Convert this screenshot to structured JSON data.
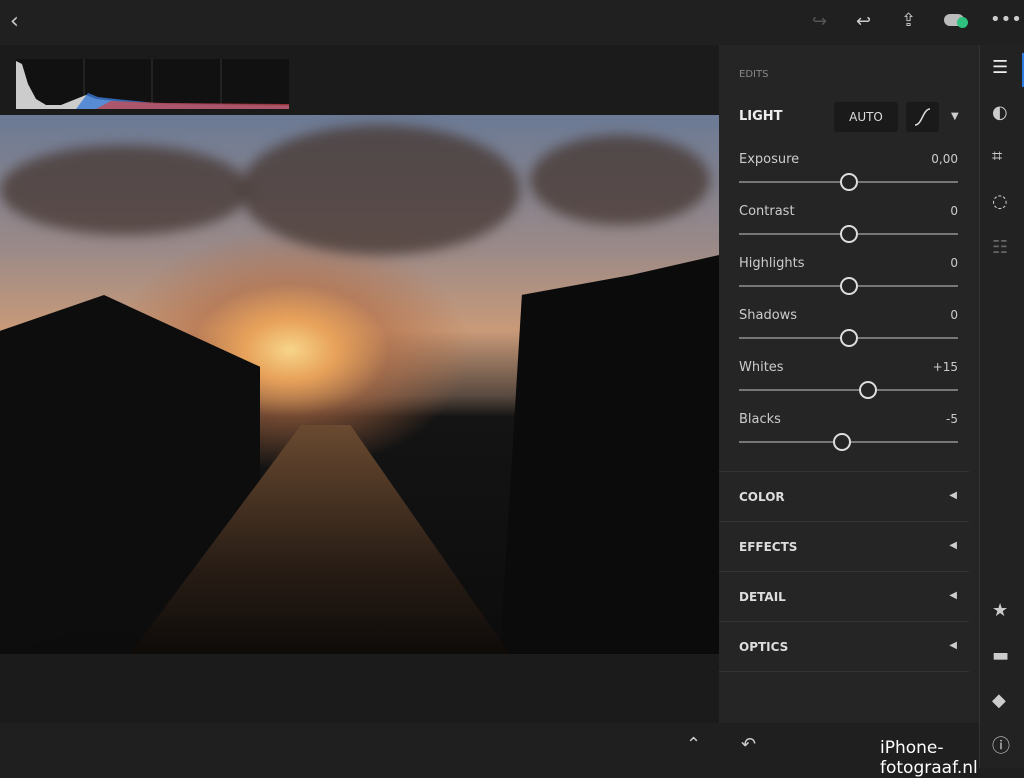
{
  "topbar": {
    "icons": [
      "back-icon",
      "redo-icon",
      "undo-icon",
      "share-icon",
      "cloud-sync-icon",
      "more-icon"
    ]
  },
  "panel": {
    "section_title": "EDITS",
    "light": {
      "title": "LIGHT",
      "auto_label": "AUTO",
      "sliders": [
        {
          "label": "Exposure",
          "value": "0,00",
          "position": 0
        },
        {
          "label": "Contrast",
          "value": "0",
          "position": 0
        },
        {
          "label": "Highlights",
          "value": "0",
          "position": 0
        },
        {
          "label": "Shadows",
          "value": "0",
          "position": 0
        },
        {
          "label": "Whites",
          "value": "+15",
          "position": 15
        },
        {
          "label": "Blacks",
          "value": "-5",
          "position": -5
        }
      ]
    },
    "sections": [
      "COLOR",
      "EFFECTS",
      "DETAIL",
      "OPTICS"
    ]
  },
  "rail": {
    "icons": [
      "edit-sliders-icon",
      "presets-icon",
      "crop-icon",
      "selective-icon",
      "versions-icon",
      "star-icon",
      "comment-icon",
      "tag-icon",
      "info-icon"
    ],
    "accent": "#2d7be0"
  },
  "cloud_status_color": "#2ec27e",
  "watermark": "iPhone-fotograaf.nl"
}
